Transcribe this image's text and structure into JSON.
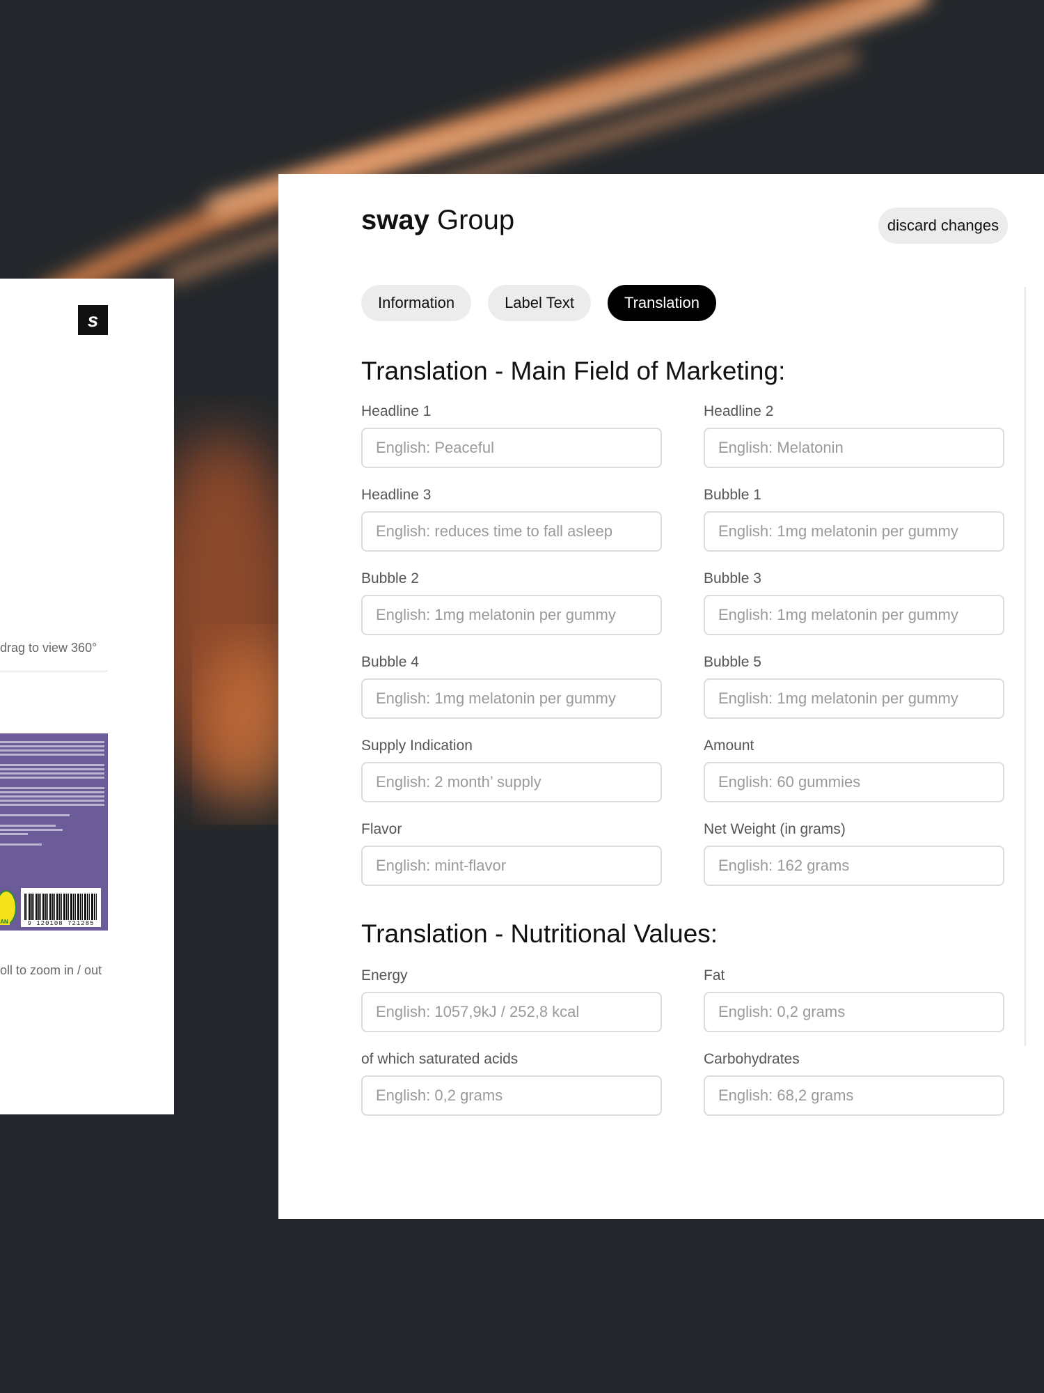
{
  "app": {
    "brand": "sway",
    "title_rest": " Group",
    "discard_label": "discard changes"
  },
  "tabs": [
    {
      "label": "Information",
      "active": false
    },
    {
      "label": "Label Text",
      "active": false
    },
    {
      "label": "Translation",
      "active": true
    }
  ],
  "preview": {
    "logo_letter": "s",
    "drag_hint": "drag to view 360°",
    "zoom_hint": "oll to zoom in / out",
    "barcode_digits": "9  120108  721285",
    "vegan_text": "GAN"
  },
  "marketing": {
    "heading": "Translation - Main Field of Marketing:",
    "fields": [
      {
        "label": "Headline 1",
        "placeholder": "English: Peaceful"
      },
      {
        "label": "Headline 2",
        "placeholder": "English: Melatonin"
      },
      {
        "label": "Headline 3",
        "placeholder": "English: reduces time to fall asleep"
      },
      {
        "label": "Bubble 1",
        "placeholder": "English: 1mg melatonin per gummy"
      },
      {
        "label": "Bubble 2",
        "placeholder": "English: 1mg melatonin per gummy"
      },
      {
        "label": "Bubble 3",
        "placeholder": "English: 1mg melatonin per gummy"
      },
      {
        "label": "Bubble 4",
        "placeholder": "English: 1mg melatonin per gummy"
      },
      {
        "label": "Bubble 5",
        "placeholder": "English: 1mg melatonin per gummy"
      },
      {
        "label": "Supply Indication",
        "placeholder": "English: 2 month’ supply"
      },
      {
        "label": "Amount",
        "placeholder": "English: 60 gummies"
      },
      {
        "label": "Flavor",
        "placeholder": "English: mint-flavor"
      },
      {
        "label": "Net Weight (in grams)",
        "placeholder": "English: 162 grams"
      }
    ]
  },
  "nutrition": {
    "heading": "Translation - Nutritional Values:",
    "fields": [
      {
        "label": "Energy",
        "placeholder": "English: 1057,9kJ / 252,8 kcal"
      },
      {
        "label": "Fat",
        "placeholder": "English: 0,2 grams"
      },
      {
        "label": "of which saturated acids",
        "placeholder": "English: 0,2 grams"
      },
      {
        "label": "Carbohydrates",
        "placeholder": "English: 68,2 grams"
      }
    ]
  },
  "colors": {
    "background": "#23272b",
    "accent_orange": "#f0965a",
    "active_tab": "#000000",
    "label_purple": "#6b5b99"
  }
}
